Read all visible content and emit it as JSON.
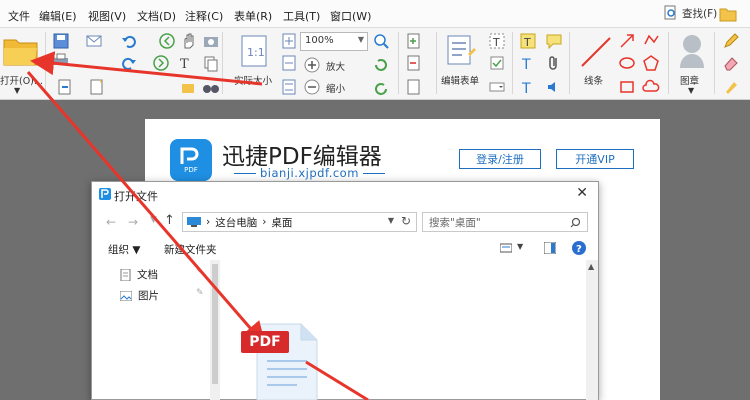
{
  "menubar": {
    "items": [
      "文件",
      "编辑(E)",
      "视图(V)",
      "文档(D)",
      "注释(C)",
      "表单(R)",
      "工具(T)",
      "窗口(W)"
    ],
    "find_label": "查找(F)"
  },
  "ribbon": {
    "open_label": "打开(O)...",
    "actual_size_label": "实际大小",
    "zoom_value": "100%",
    "zoom_in_label": "放大",
    "zoom_out_label": "缩小",
    "edit_form_label": "编辑表单",
    "line_label": "线条",
    "stamp_label": "图章"
  },
  "brand": {
    "logo_text": "PDF",
    "title": "迅捷PDF编辑器",
    "url": "bianji.xjpdf.com",
    "login_label": "登录/注册",
    "vip_label": "开通VIP"
  },
  "dialog": {
    "title": "打开文件",
    "path": [
      "这台电脑",
      "桌面"
    ],
    "search_placeholder": "搜索\"桌面\"",
    "organize_label": "组织 ▼",
    "new_folder_label": "新建文件夹",
    "nav_items": [
      {
        "label": "文档",
        "icon": "document-icon"
      },
      {
        "label": "图片",
        "icon": "picture-icon"
      }
    ]
  },
  "pdf_file": {
    "badge": "PDF"
  },
  "colors": {
    "accent": "#1f6fc0",
    "arrow": "#e8352b",
    "pdf_red": "#d72b2b",
    "brand_blue": "#1f8fe3"
  }
}
